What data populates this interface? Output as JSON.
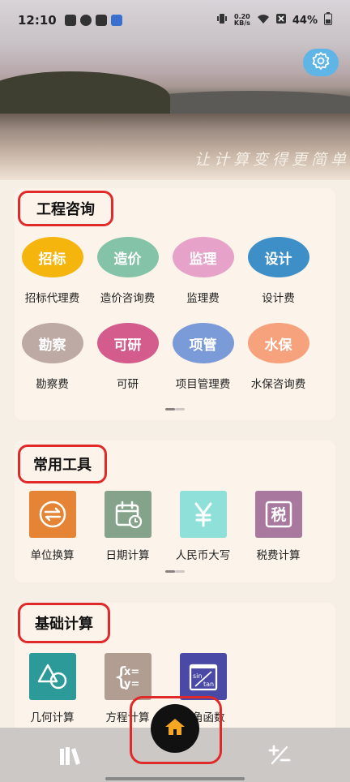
{
  "status_bar": {
    "time": "12:10",
    "net_speed_value": "0.20",
    "net_speed_unit": "KB/s",
    "battery": "44%"
  },
  "hero": {
    "slogan": "让计算变得更简单",
    "settings_icon": "gear-icon"
  },
  "sections": {
    "engineering": {
      "title": "工程咨询",
      "items": [
        {
          "badge": "招标",
          "label": "招标代理费",
          "color": "#f5b50c"
        },
        {
          "badge": "造价",
          "label": "造价咨询费",
          "color": "#84c3a7"
        },
        {
          "badge": "监理",
          "label": "监理费",
          "color": "#e6a2c9"
        },
        {
          "badge": "设计",
          "label": "设计费",
          "color": "#3e8fc8"
        },
        {
          "badge": "勘察",
          "label": "勘察费",
          "color": "#bdaaa5"
        },
        {
          "badge": "可研",
          "label": "可研",
          "color": "#d35c8c"
        },
        {
          "badge": "项管",
          "label": "项目管理费",
          "color": "#7b9bd8"
        },
        {
          "badge": "水保",
          "label": "水保咨询费",
          "color": "#f5a27d"
        }
      ]
    },
    "tools": {
      "title": "常用工具",
      "items": [
        {
          "label": "单位换算",
          "icon": "convert-icon",
          "color": "#e58434"
        },
        {
          "label": "日期计算",
          "icon": "calendar-icon",
          "color": "#84a38a"
        },
        {
          "label": "人民币大写",
          "icon": "yuan-icon",
          "color": "#8ee0d8"
        },
        {
          "label": "税费计算",
          "icon": "tax-icon",
          "color": "#a8789e"
        }
      ]
    },
    "basic": {
      "title": "基础计算",
      "items": [
        {
          "label": "几何计算",
          "icon": "geometry-icon",
          "color": "#2c9a98"
        },
        {
          "label": "方程计算",
          "icon": "equation-icon",
          "color": "#b19d92"
        },
        {
          "label": "三角函数",
          "icon": "trig-icon",
          "color": "#4a4aa6"
        }
      ]
    }
  },
  "bottom_nav": {
    "left_icon": "books-icon",
    "center_icon": "home-icon",
    "right_icon": "plus-minus-icon",
    "home_color": "#f5a623"
  }
}
